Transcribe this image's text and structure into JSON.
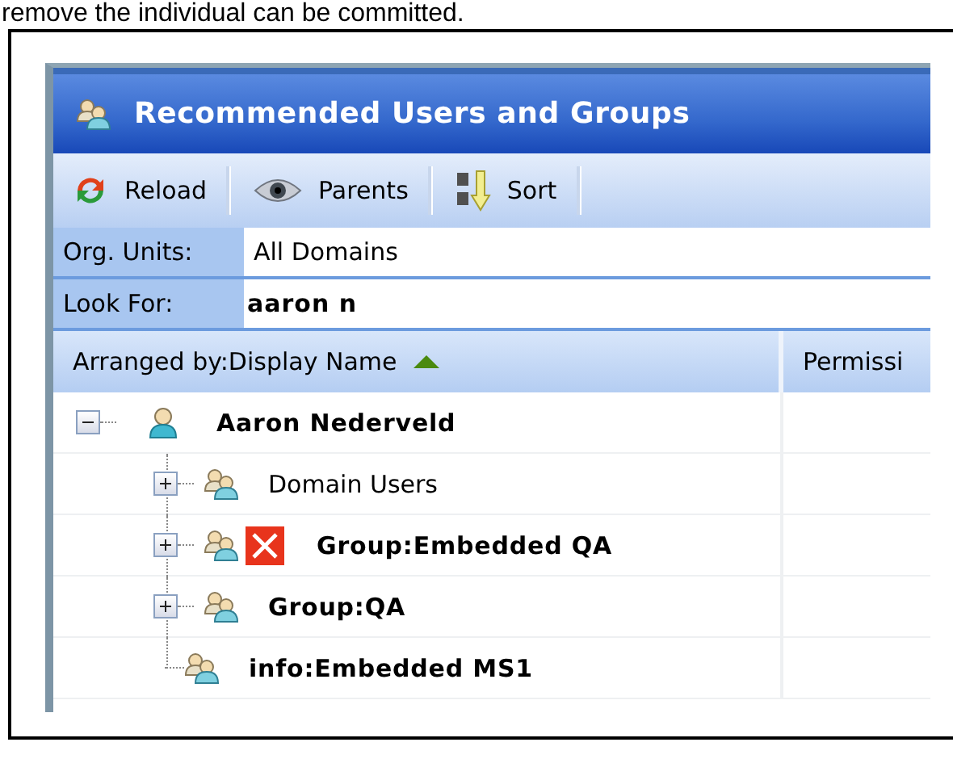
{
  "caption": "remove the individual can be committed.",
  "window": {
    "title": "Recommended Users and Groups"
  },
  "toolbar": [
    {
      "label": "Reload",
      "kind": "reload"
    },
    {
      "label": "Parents",
      "kind": "parents"
    },
    {
      "label": "Sort",
      "kind": "sort"
    }
  ],
  "filters": [
    {
      "label": "Org. Units:",
      "value": "All Domains",
      "bold": false
    },
    {
      "label": "Look For:",
      "value": "aaron  n",
      "bold": true
    }
  ],
  "columns": [
    {
      "label": "Arranged by:Display Name",
      "sorted": true
    },
    {
      "label": "Permissi",
      "sorted": false
    }
  ],
  "tree": [
    {
      "name": "Aaron Nederveld",
      "kind": "user",
      "bold": true,
      "has_children": true,
      "expanded": true,
      "flagged": false,
      "children": [
        {
          "name": "Domain Users",
          "kind": "group",
          "bold": false,
          "has_children": true,
          "expanded": false,
          "flagged": false
        },
        {
          "name": "Group:Embedded QA",
          "kind": "group",
          "bold": true,
          "has_children": true,
          "expanded": false,
          "flagged": true
        },
        {
          "name": "Group:QA",
          "kind": "group",
          "bold": true,
          "has_children": true,
          "expanded": false,
          "flagged": false
        },
        {
          "name": "info:Embedded MS1",
          "kind": "group",
          "bold": true,
          "has_children": false,
          "expanded": false,
          "flagged": false
        }
      ]
    }
  ]
}
